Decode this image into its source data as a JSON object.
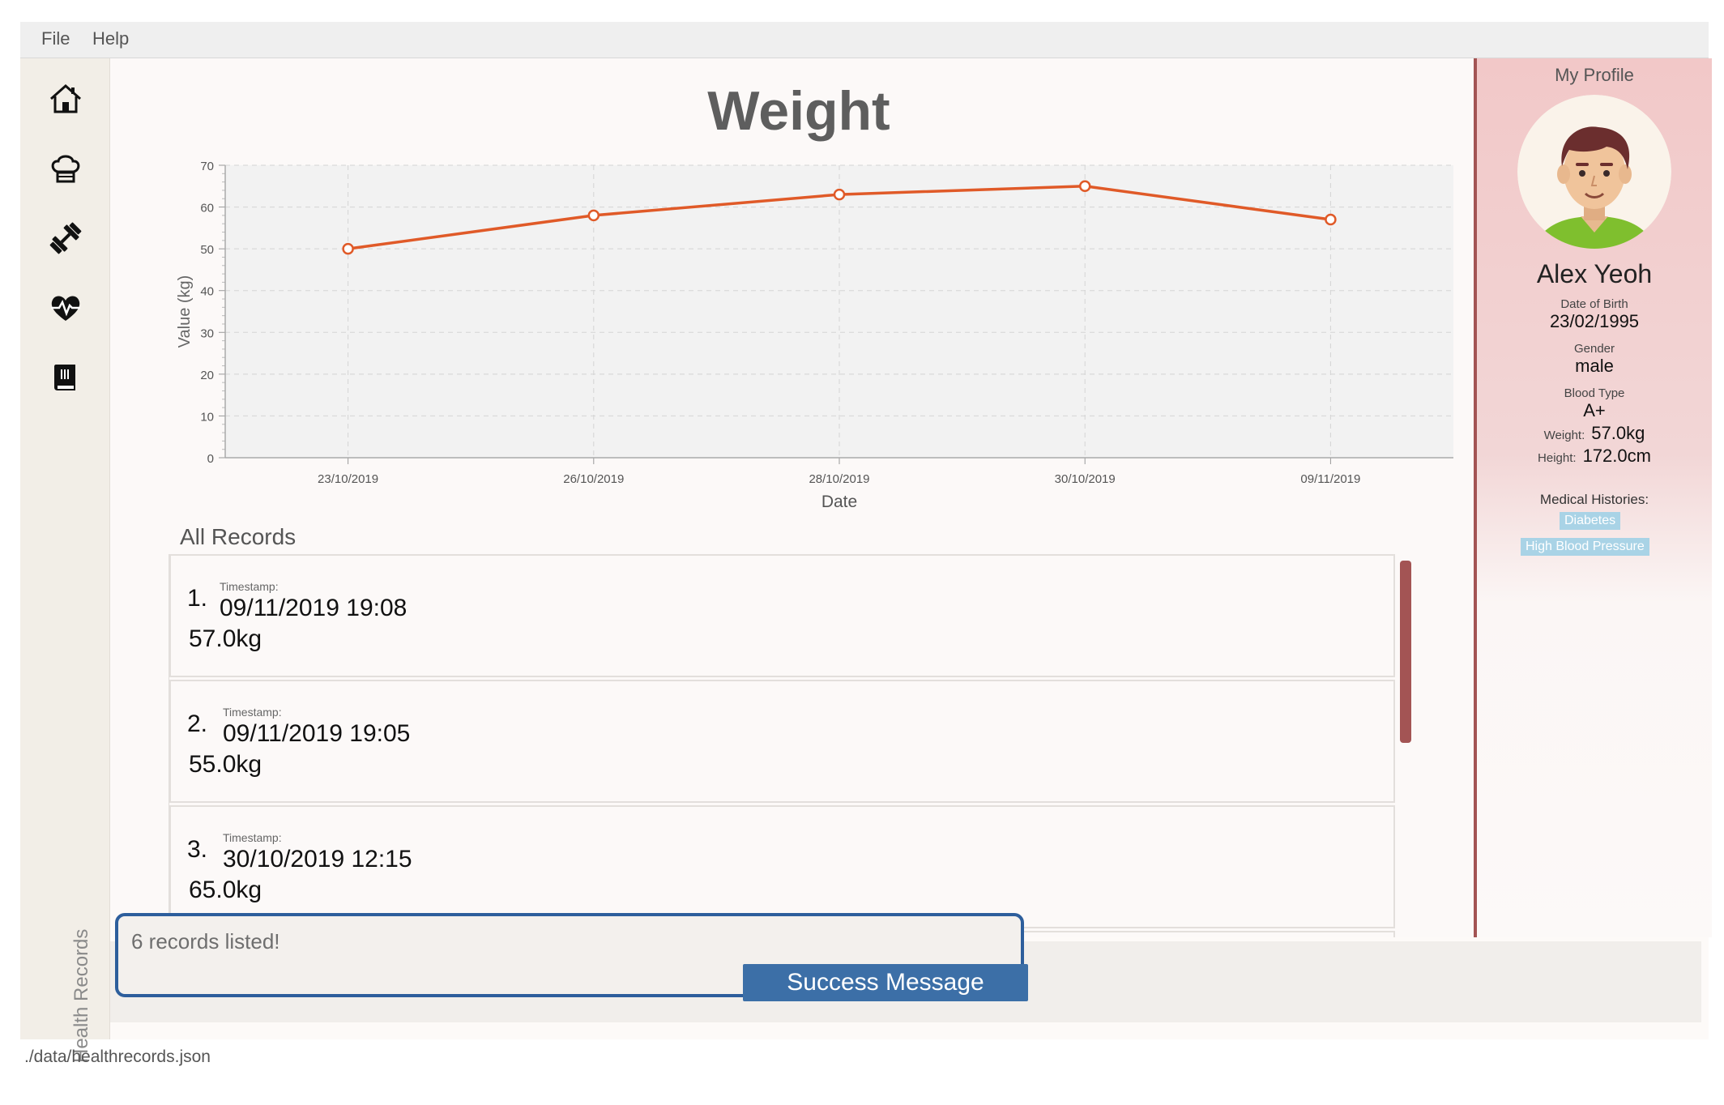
{
  "menu": {
    "file": "File",
    "help": "Help"
  },
  "nav": {
    "items": [
      {
        "name": "home-icon"
      },
      {
        "name": "chef-hat-icon"
      },
      {
        "name": "dumbbell-icon"
      },
      {
        "name": "heartbeat-icon"
      },
      {
        "name": "book-icon"
      }
    ],
    "section_label": "Health Records"
  },
  "page": {
    "title": "Weight"
  },
  "chart_data": {
    "type": "line",
    "title": "",
    "xlabel": "Date",
    "ylabel": "Value (kg)",
    "ylim": [
      0,
      70
    ],
    "yticks": [
      0,
      10,
      20,
      30,
      40,
      50,
      60,
      70
    ],
    "categories": [
      "23/10/2019",
      "26/10/2019",
      "28/10/2019",
      "30/10/2019",
      "09/11/2019"
    ],
    "series": [
      {
        "values": [
          50,
          58,
          63,
          65,
          57
        ]
      }
    ],
    "grid": true,
    "color": "#e05a28"
  },
  "records": {
    "title": "All Records",
    "timestamp_label": "Timestamp:",
    "items": [
      {
        "index": "1.",
        "timestamp": "09/11/2019 19:08",
        "value": "57.0kg"
      },
      {
        "index": "2.",
        "timestamp": "09/11/2019 19:05",
        "value": "55.0kg"
      },
      {
        "index": "3.",
        "timestamp": "30/10/2019 12:15",
        "value": "65.0kg"
      }
    ]
  },
  "profile": {
    "header": "My Profile",
    "name": "Alex Yeoh",
    "dob_label": "Date of Birth",
    "dob": "23/02/1995",
    "gender_label": "Gender",
    "gender": "male",
    "blood_label": "Blood Type",
    "blood": "A+",
    "weight_label": "Weight:",
    "weight": "57.0kg",
    "height_label": "Height:",
    "height": "172.0cm",
    "med_title": "Medical Histories:",
    "med_tags": [
      "Diabetes",
      "High Blood Pressure"
    ]
  },
  "result": {
    "message": "6 records listed!",
    "banner": "Success Message"
  },
  "status": {
    "path": "./data/healthrecords.json"
  },
  "colors": {
    "accent": "#a35454",
    "series": "#e05a28",
    "banner": "#3c6fa7",
    "border": "#2d5e9c"
  }
}
